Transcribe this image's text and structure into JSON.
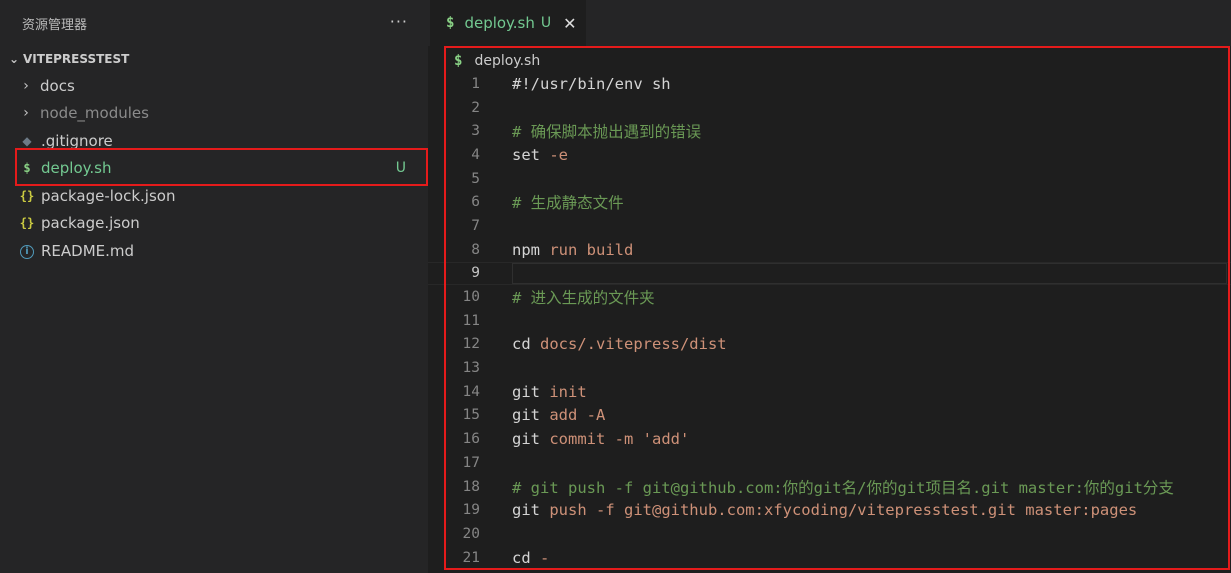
{
  "sidebar": {
    "title": "资源管理器",
    "more_label": "···",
    "root": "VITEPRESSTEST",
    "items": [
      {
        "label": "docs",
        "type": "folder"
      },
      {
        "label": "node_modules",
        "type": "folder"
      },
      {
        "label": ".gitignore",
        "type": "file",
        "icon": "git-icon"
      },
      {
        "label": "deploy.sh",
        "type": "file",
        "icon": "shell-icon",
        "badge": "U"
      },
      {
        "label": "package-lock.json",
        "type": "file",
        "icon": "json-icon"
      },
      {
        "label": "package.json",
        "type": "file",
        "icon": "json-icon"
      },
      {
        "label": "README.md",
        "type": "file",
        "icon": "info-icon"
      }
    ]
  },
  "tab": {
    "label": "deploy.sh",
    "badge": "U",
    "close": "✕"
  },
  "breadcrumb": "deploy.sh",
  "icons": {
    "dollar": "$",
    "json": "{}",
    "info": "i",
    "git": "◆"
  },
  "colors": {
    "untracked": "#73c991",
    "highlight_border": "#e51b1b",
    "comment": "#6a9955",
    "string": "#ce9178"
  },
  "code": {
    "lines": [
      {
        "n": "1",
        "cmd": "#!/usr/bin/env sh",
        "arg": "",
        "kind": "plain"
      },
      {
        "n": "2",
        "cmd": "",
        "arg": "",
        "kind": "plain"
      },
      {
        "n": "3",
        "cmd": "# 确保脚本抛出遇到的错误",
        "arg": "",
        "kind": "comment"
      },
      {
        "n": "4",
        "cmd": "set",
        "arg": " -e",
        "kind": "cmd"
      },
      {
        "n": "5",
        "cmd": "",
        "arg": "",
        "kind": "plain"
      },
      {
        "n": "6",
        "cmd": "# 生成静态文件",
        "arg": "",
        "kind": "comment"
      },
      {
        "n": "7",
        "cmd": "",
        "arg": "",
        "kind": "plain"
      },
      {
        "n": "8",
        "cmd": "npm",
        "arg": " run build",
        "kind": "cmd"
      },
      {
        "n": "9",
        "cmd": "",
        "arg": "",
        "kind": "current"
      },
      {
        "n": "10",
        "cmd": "# 进入生成的文件夹",
        "arg": "",
        "kind": "comment"
      },
      {
        "n": "11",
        "cmd": "",
        "arg": "",
        "kind": "plain"
      },
      {
        "n": "12",
        "cmd": "cd",
        "arg": " docs/.vitepress/dist",
        "kind": "cmd"
      },
      {
        "n": "13",
        "cmd": "",
        "arg": "",
        "kind": "plain"
      },
      {
        "n": "14",
        "cmd": "git",
        "arg": " init",
        "kind": "cmd"
      },
      {
        "n": "15",
        "cmd": "git",
        "arg": " add -A",
        "kind": "cmd"
      },
      {
        "n": "16",
        "cmd": "git",
        "arg": " commit -m 'add'",
        "kind": "cmd"
      },
      {
        "n": "17",
        "cmd": "",
        "arg": "",
        "kind": "plain"
      },
      {
        "n": "18",
        "cmd": "# git push -f git@github.com:你的git名/你的git项目名.git master:你的git分支",
        "arg": "",
        "kind": "comment"
      },
      {
        "n": "19",
        "cmd": "git",
        "arg": " push -f git@github.com:xfycoding/vitepresstest.git master:pages",
        "kind": "cmd"
      },
      {
        "n": "20",
        "cmd": "",
        "arg": "",
        "kind": "plain"
      },
      {
        "n": "21",
        "cmd": "cd",
        "arg": " -",
        "kind": "cmd"
      }
    ]
  }
}
